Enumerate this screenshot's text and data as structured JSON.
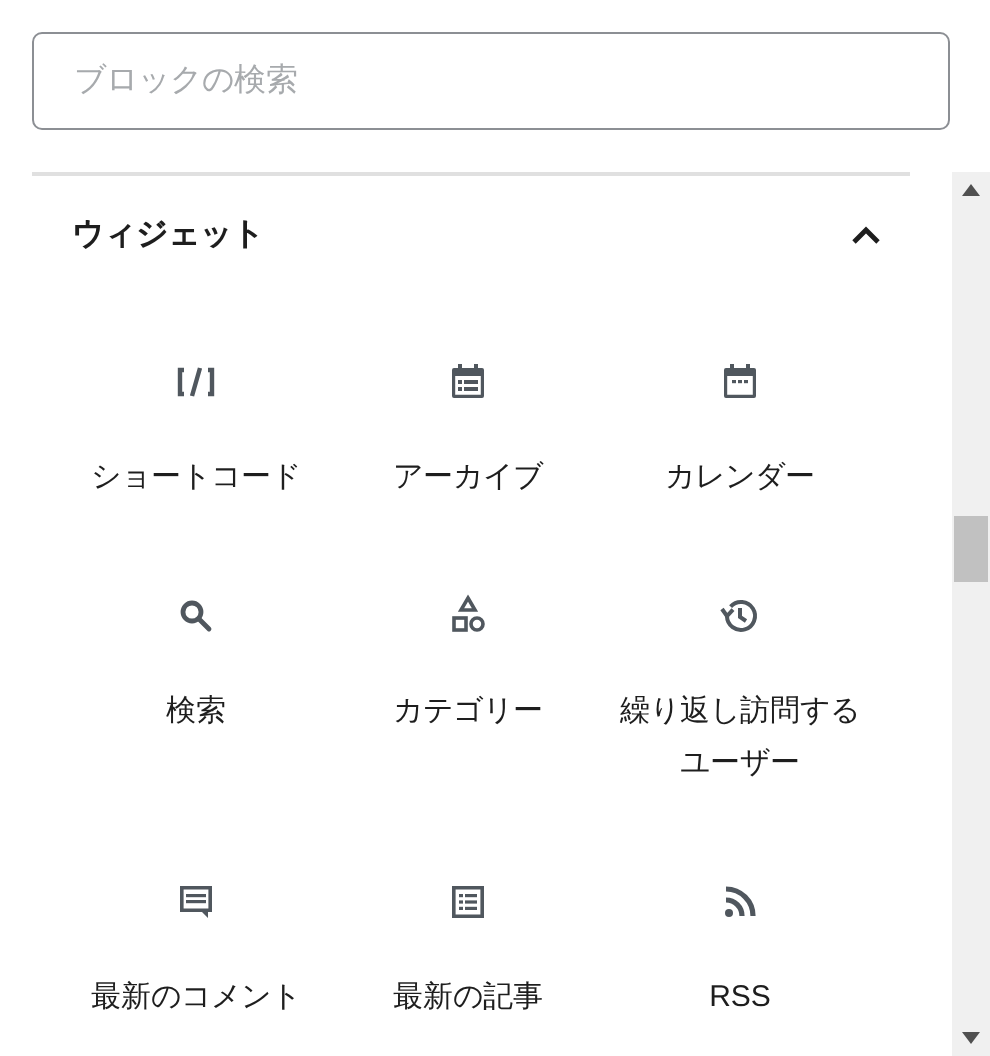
{
  "search": {
    "placeholder": "ブロックの検索"
  },
  "panel": {
    "title": "ウィジェット",
    "expanded": true,
    "blocks": [
      {
        "label": "ショートコード"
      },
      {
        "label": "アーカイブ"
      },
      {
        "label": "カレンダー"
      },
      {
        "label": "検索"
      },
      {
        "label": "カテゴリー"
      },
      {
        "label": "繰り返し訪問するユーザー"
      },
      {
        "label": "最新のコメント"
      },
      {
        "label": "最新の記事"
      },
      {
        "label": "RSS"
      }
    ]
  }
}
